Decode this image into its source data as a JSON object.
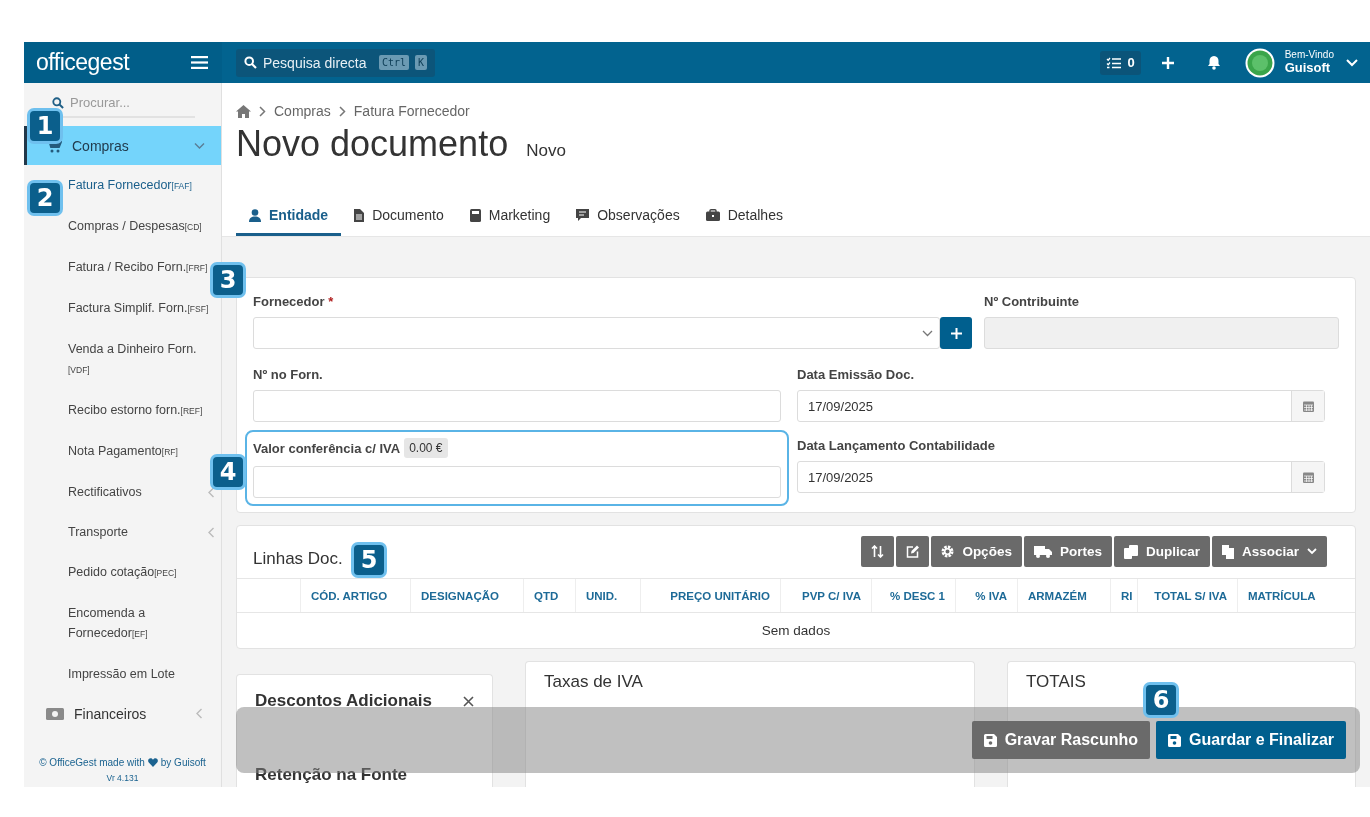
{
  "topbar": {
    "logo": "officegest",
    "search": {
      "placeholder": "Pesquisa directa",
      "keys": [
        "Ctrl",
        "K"
      ]
    },
    "tasks_count": "0",
    "greeting": "Bem-Vindo",
    "user": "Guisoft"
  },
  "sidebar": {
    "search": {
      "placeholder": "Procurar..."
    },
    "items": [
      {
        "label": "Compras",
        "selected": true,
        "expanded": true,
        "children": [
          {
            "label": "Fatura Fornecedor",
            "code": "[FAF]",
            "selected": true
          },
          {
            "label": "Compras / Despesas",
            "code": "[CD]",
            "selected": false
          },
          {
            "label": "Fatura / Recibo Forn.",
            "code": "[FRF]",
            "selected": false
          },
          {
            "label": "Factura Simplif. Forn.",
            "code": "[FSF]",
            "selected": false
          },
          {
            "label": "Venda a Dinheiro Forn.",
            "code": "[VDF]",
            "selected": false
          },
          {
            "label": "Recibo estorno forn.",
            "code": "[REF]",
            "selected": false
          },
          {
            "label": "Nota Pagamento",
            "code": "[RF]",
            "selected": false
          },
          {
            "label": "Rectificativos",
            "kind": "submenu",
            "selected": false
          },
          {
            "label": "Transporte",
            "kind": "submenu",
            "selected": false
          },
          {
            "label": "Pedido cotação",
            "code": "[PEC]",
            "selected": false
          },
          {
            "label": "Encomenda a Fornecedor",
            "code": "[EF]",
            "selected": false
          },
          {
            "label": "Impressão em Lote",
            "selected": false
          }
        ]
      },
      {
        "label": "Financeiros",
        "selected": false,
        "expanded": false
      }
    ],
    "footer": {
      "credit": "© OfficeGest made with",
      "by": "by Guisoft",
      "version": "Vr 4.131"
    }
  },
  "breadcrumb": [
    "Compras",
    "Fatura Fornecedor"
  ],
  "title": "Novo documento",
  "subtitle": "Novo",
  "tabs": [
    {
      "label": "Entidade",
      "selected": true
    },
    {
      "label": "Documento",
      "selected": false
    },
    {
      "label": "Marketing",
      "selected": false
    },
    {
      "label": "Observações",
      "selected": false
    },
    {
      "label": "Detalhes",
      "selected": false
    }
  ],
  "form": {
    "supplier": {
      "label": "Fornecedor",
      "required_mark": "*"
    },
    "taxpayer": {
      "label": "Nº Contribuinte",
      "disabled": true
    },
    "supplier_number": {
      "label": "Nº no Forn."
    },
    "issue_date": {
      "label": "Data Emissão Doc.",
      "value": "17/09/2025"
    },
    "check_value": {
      "label": "Valor conferência c/ IVA",
      "badge": "0.00 €",
      "highlighted": true
    },
    "posting_date": {
      "label": "Data Lançamento Contabilidade",
      "value": "17/09/2025"
    }
  },
  "lines": {
    "title": "Linhas Doc.",
    "buttons": [
      {
        "label": "Opções"
      },
      {
        "label": "Portes"
      },
      {
        "label": "Duplicar"
      },
      {
        "label": "Associar",
        "dropdown": true
      }
    ],
    "columns": [
      {
        "label": "CÓD. ARTIGO",
        "numeric": false
      },
      {
        "label": "DESIGNAÇÃO",
        "numeric": false
      },
      {
        "label": "QTD",
        "numeric": false
      },
      {
        "label": "UNID.",
        "numeric": false
      },
      {
        "label": "PREÇO UNITÁRIO",
        "numeric": true
      },
      {
        "label": "PVP C/ IVA",
        "numeric": true
      },
      {
        "label": "% DESC 1",
        "numeric": true
      },
      {
        "label": "% IVA",
        "numeric": true
      },
      {
        "label": "ARMAZÉM",
        "numeric": false
      },
      {
        "label": "RI",
        "numeric": false
      },
      {
        "label": "TOTAL S/ IVA",
        "numeric": true
      },
      {
        "label": "MATRÍCULA",
        "numeric": false
      }
    ],
    "empty": "Sem dados"
  },
  "panels": {
    "discounts": "Descontos Adicionais",
    "withholding": "Retenção na Fonte",
    "vat": "Taxas de IVA",
    "totals": "TOTAIS"
  },
  "actions": [
    {
      "label": "Gravar Rascunho",
      "kind": "secondary"
    },
    {
      "label": "Guardar e Finalizar",
      "kind": "primary"
    }
  ],
  "callouts": [
    "1",
    "2",
    "3",
    "4",
    "5",
    "6"
  ]
}
